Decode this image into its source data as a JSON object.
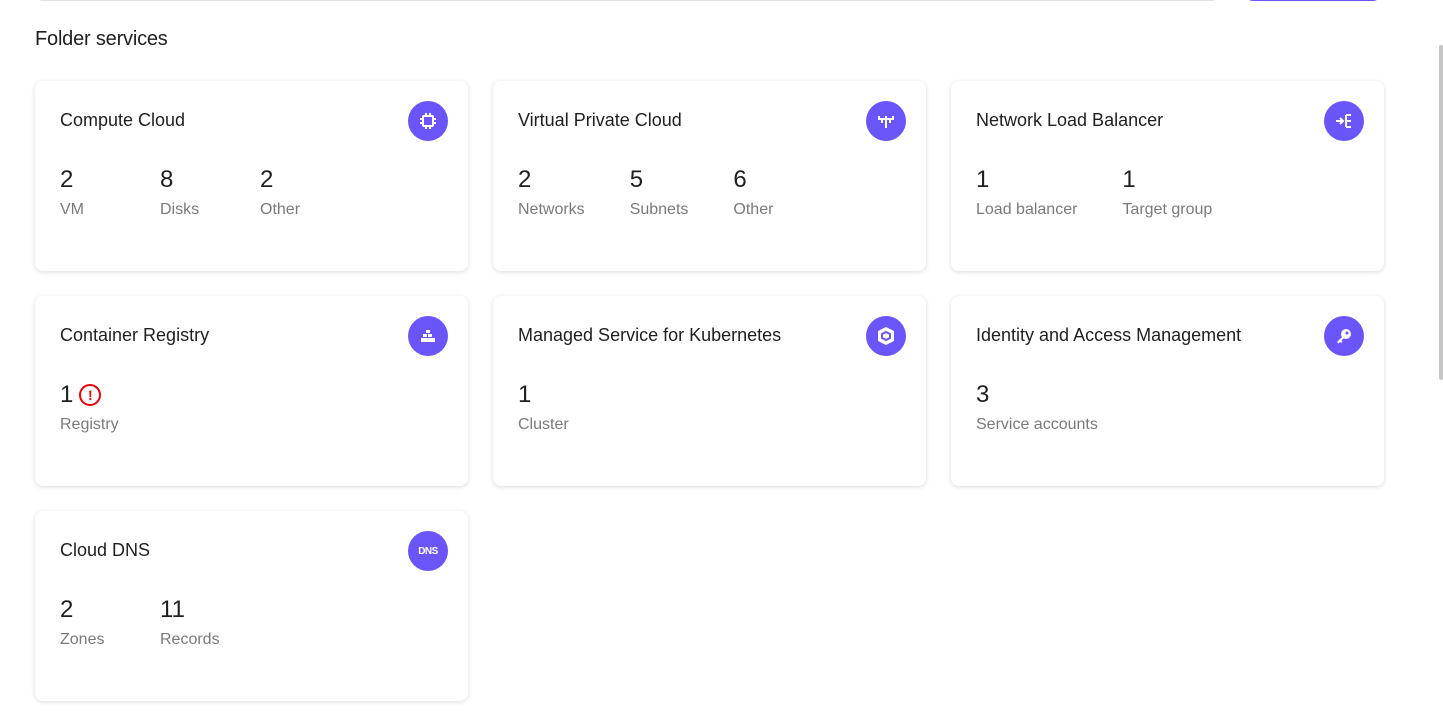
{
  "heading": "Folder services",
  "colors": {
    "accent": "#6a55f9",
    "error": "#e8000b"
  },
  "services": [
    {
      "title": "Compute Cloud",
      "icon": "cpu-icon",
      "stats": [
        {
          "value": "2",
          "label": "VM"
        },
        {
          "value": "8",
          "label": "Disks"
        },
        {
          "value": "2",
          "label": "Other"
        }
      ]
    },
    {
      "title": "Virtual Private Cloud",
      "icon": "network-icon",
      "stats": [
        {
          "value": "2",
          "label": "Networks"
        },
        {
          "value": "5",
          "label": "Subnets"
        },
        {
          "value": "6",
          "label": "Other"
        }
      ]
    },
    {
      "title": "Network Load Balancer",
      "icon": "load-balancer-icon",
      "stats": [
        {
          "value": "1",
          "label": "Load balancer"
        },
        {
          "value": "1",
          "label": "Target group"
        }
      ]
    },
    {
      "title": "Container Registry",
      "icon": "container-icon",
      "stats": [
        {
          "value": "1",
          "label": "Registry",
          "error": true
        }
      ]
    },
    {
      "title": "Managed Service for Kubernetes",
      "icon": "kubernetes-icon",
      "stats": [
        {
          "value": "1",
          "label": "Cluster"
        }
      ]
    },
    {
      "title": "Identity and Access Management",
      "icon": "key-icon",
      "stats": [
        {
          "value": "3",
          "label": "Service accounts"
        }
      ]
    },
    {
      "title": "Cloud DNS",
      "icon": "dns-icon",
      "icon_text": "DNS",
      "stats": [
        {
          "value": "2",
          "label": "Zones"
        },
        {
          "value": "11",
          "label": "Records"
        }
      ]
    }
  ]
}
